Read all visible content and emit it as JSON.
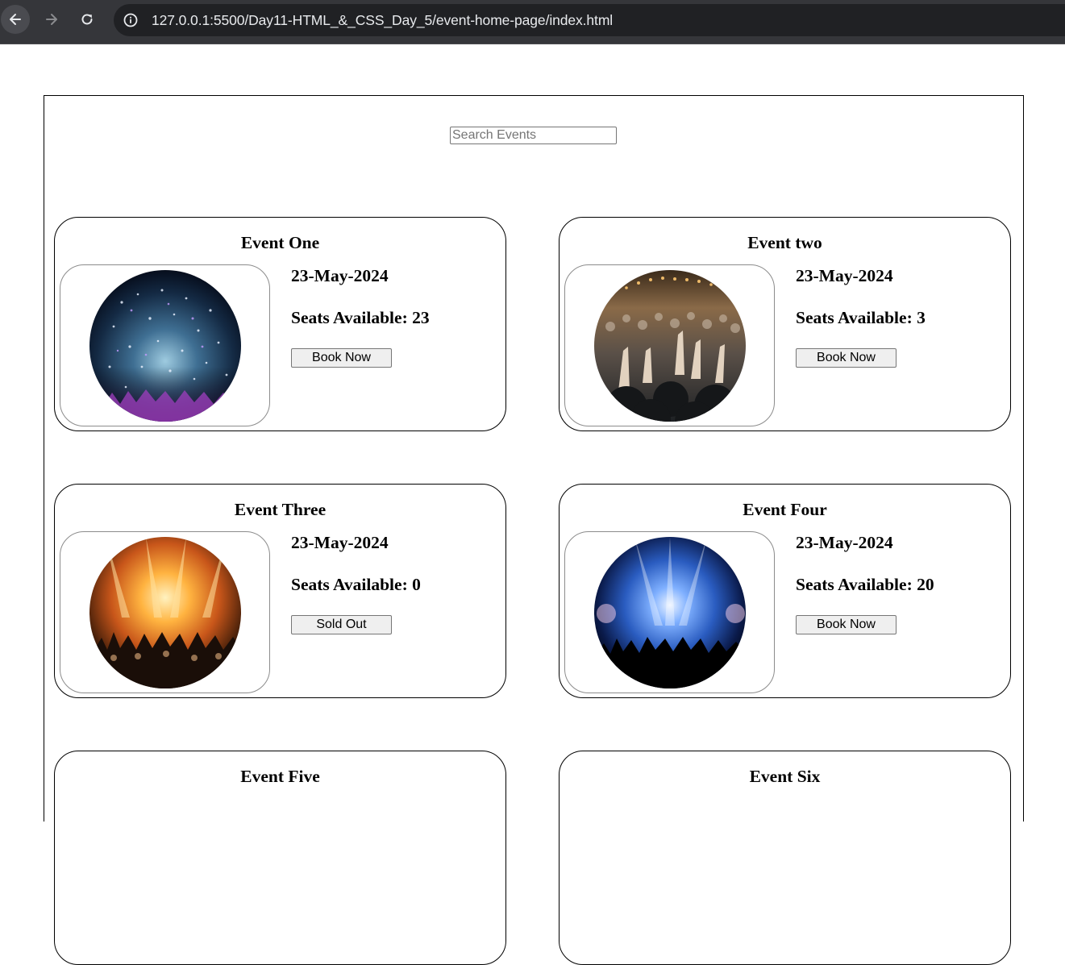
{
  "browser": {
    "url": "127.0.0.1:5500/Day11-HTML_&_CSS_Day_5/event-home-page/index.html"
  },
  "search": {
    "placeholder": "Search Events"
  },
  "events": [
    {
      "title": "Event One",
      "date": "23-May-2024",
      "seats": "Seats Available: 23",
      "button": "Book Now",
      "image": "confetti-concert-photo"
    },
    {
      "title": "Event two",
      "date": "23-May-2024",
      "seats": "Seats Available: 3",
      "button": "Book Now",
      "image": "crowd-hands-photo"
    },
    {
      "title": "Event Three",
      "date": "23-May-2024",
      "seats": "Seats Available: 0",
      "button": "Sold Out",
      "image": "orange-stage-lights-photo"
    },
    {
      "title": "Event Four",
      "date": "23-May-2024",
      "seats": "Seats Available: 20",
      "button": "Book Now",
      "image": "blue-stage-lights-photo"
    },
    {
      "title": "Event Five"
    },
    {
      "title": "Event Six"
    }
  ],
  "colors": {
    "chrome_bg": "#35363a",
    "omnibox_bg": "#202124",
    "url_text": "#e8eaed",
    "button_bg": "#efefef"
  }
}
